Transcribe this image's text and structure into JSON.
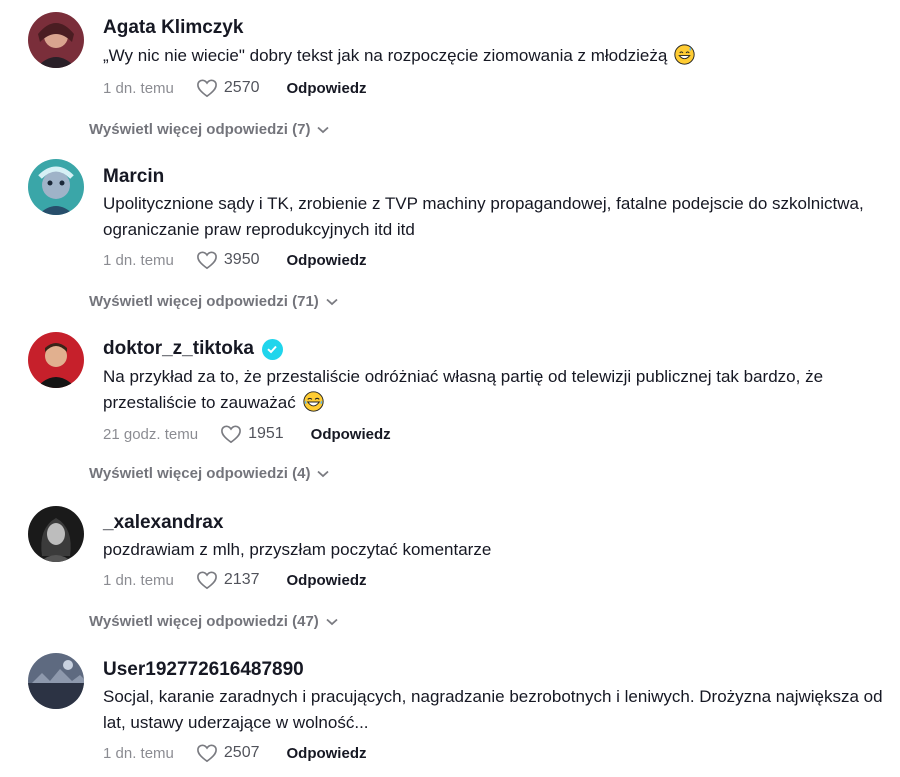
{
  "comments": [
    {
      "username": "Agata Klimczyk",
      "text": "„Wy nic nie wiecie\" dobry tekst jak na rozpoczęcie ziomowania z młodzieżą",
      "emoji": "sweat-smile-emoji",
      "time": "1 dn. temu",
      "likes": "2570",
      "reply_label": "Odpowiedz",
      "more_replies": "Wyświetl więcej odpowiedzi (7)"
    },
    {
      "username": "Marcin",
      "text": "Upolitycznione sądy i TK, zrobienie z TVP machiny propagandowej, fatalne podejscie do szkolnictwa, ograniczanie praw reprodukcyjnych itd itd",
      "time": "1 dn. temu",
      "likes": "3950",
      "reply_label": "Odpowiedz",
      "more_replies": "Wyświetl więcej odpowiedzi (71)"
    },
    {
      "username": "doktor_z_tiktoka",
      "verified": true,
      "text": "Na przykład za to, że przestaliście odróżniać własną partię od telewizji publicznej tak bardzo, że przestaliście to zauważać",
      "emoji": "joy-emoji",
      "time": "21 godz. temu",
      "likes": "1951",
      "reply_label": "Odpowiedz",
      "more_replies": "Wyświetl więcej odpowiedzi (4)"
    },
    {
      "username": "_xalexandrax",
      "text": "pozdrawiam z mlh, przyszłam poczytać komentarze",
      "time": "1 dn. temu",
      "likes": "2137",
      "reply_label": "Odpowiedz",
      "more_replies": "Wyświetl więcej odpowiedzi (47)"
    },
    {
      "username": "User192772616487890",
      "text": "Socjal, karanie zaradnych i pracujących, nagradzanie bezrobotnych i leniwych. Drożyzna największa od lat, ustawy uderzające w wolność...",
      "time": "1 dn. temu",
      "likes": "2507",
      "reply_label": "Odpowiedz"
    }
  ]
}
